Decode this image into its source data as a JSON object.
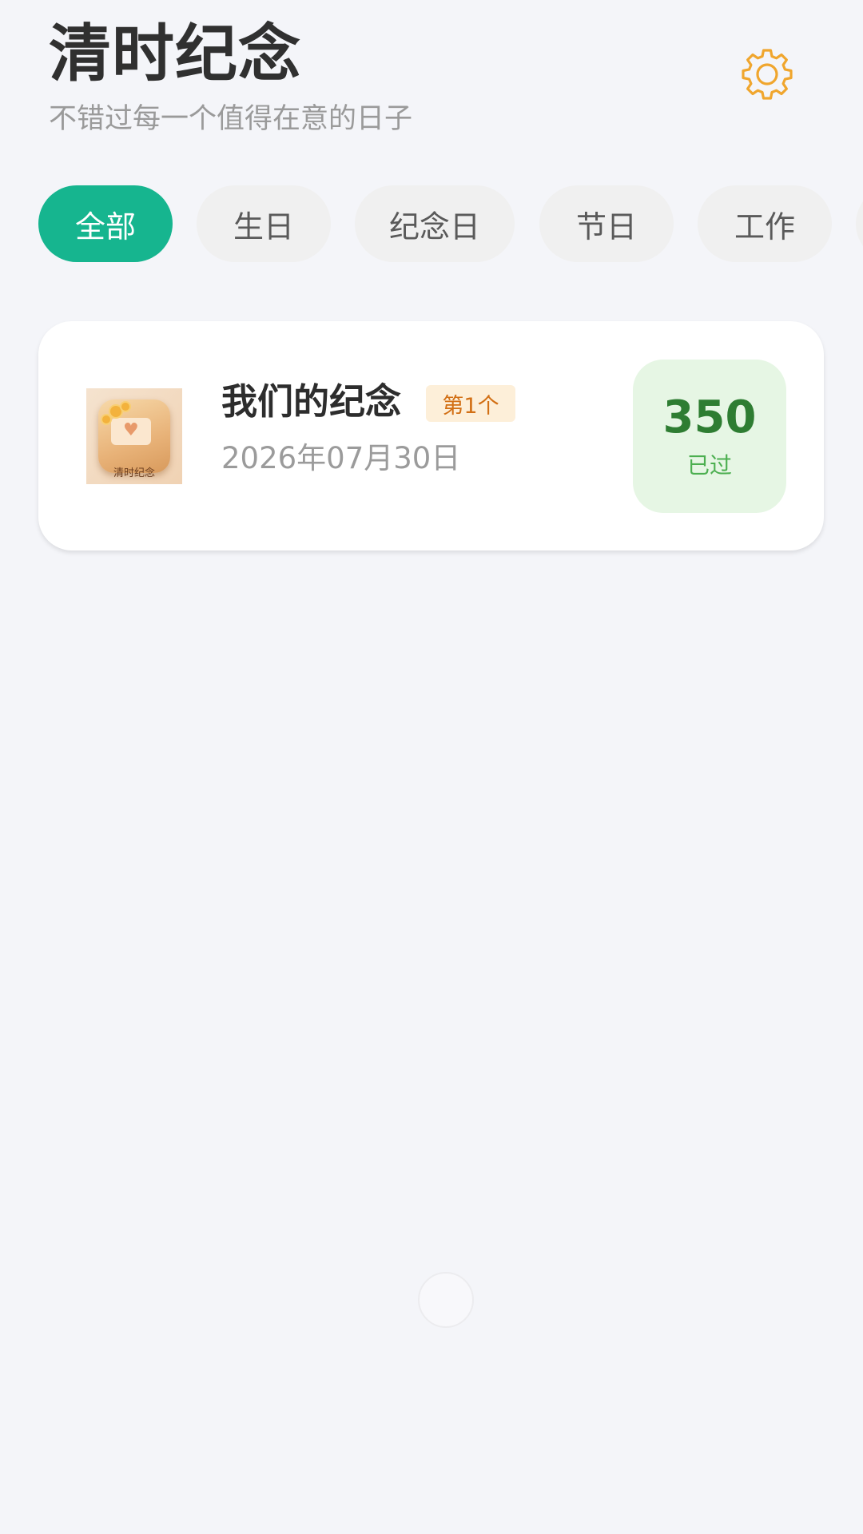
{
  "header": {
    "title": "清时纪念",
    "subtitle": "不错过每一个值得在意的日子",
    "settings_icon": "gear-icon",
    "settings_color": "#f0a62e"
  },
  "tabs": [
    {
      "label": "全部",
      "active": true
    },
    {
      "label": "生日",
      "active": false
    },
    {
      "label": "纪念日",
      "active": false
    },
    {
      "label": "节日",
      "active": false
    },
    {
      "label": "工作",
      "active": false
    }
  ],
  "accent_color": "#16b58f",
  "events": [
    {
      "title": "我们的纪念",
      "rank_badge": "第1个",
      "date": "2026年07月30日",
      "days": "350",
      "days_label": "已过",
      "thumbnail_caption": "清时纪念",
      "count_color": "#2e7d32",
      "count_bg": "#e6f6e4"
    }
  ],
  "float_button_icon": "circle-icon"
}
